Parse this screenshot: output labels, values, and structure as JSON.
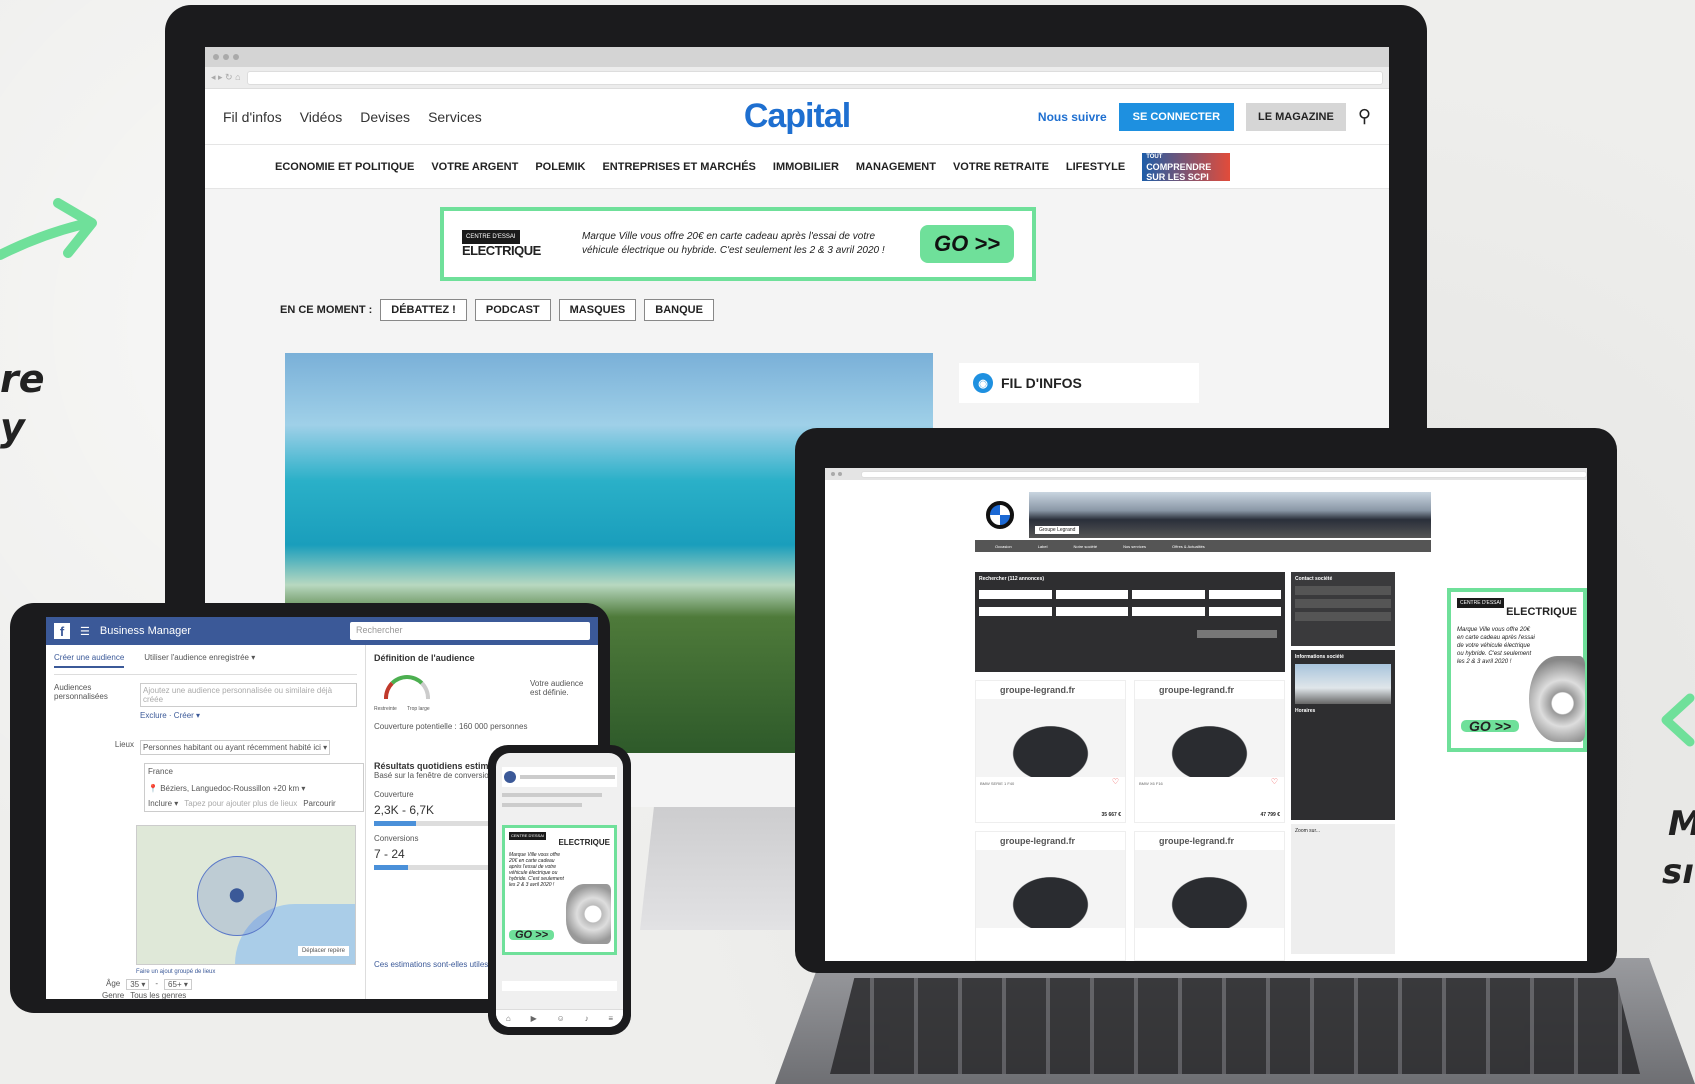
{
  "side_left": {
    "line1": "re",
    "line2": "y"
  },
  "side_right": {
    "line1": "M",
    "line2": "sı"
  },
  "capital": {
    "top_links": [
      "Fil d'infos",
      "Vidéos",
      "Devises",
      "Services"
    ],
    "logo": "Capital",
    "follow": "Nous suivre",
    "connect": "SE CONNECTER",
    "magazine": "LE MAGAZINE",
    "nav": [
      "ECONOMIE ET POLITIQUE",
      "VOTRE ARGENT",
      "POLEMIK",
      "ENTREPRISES ET MARCHÉS",
      "IMMOBILIER",
      "MANAGEMENT",
      "VOTRE RETRAITE",
      "LIFESTYLE"
    ],
    "scpi_line1": "TOUT",
    "scpi_line2": "COMPRENDRE",
    "scpi_line3": "SUR LES SCPI",
    "banner": {
      "tag": "CENTRE D'ESSAI",
      "brand": "ELECTRIQUE",
      "text": "Marque Ville vous offre 20€ en carte cadeau après l'essai de votre véhicule électrique ou hybride. C'est seulement les 2 & 3 avril 2020 !",
      "go": "GO >>"
    },
    "moment_label": "EN CE MOMENT :",
    "moment_tags": [
      "DÉBATTEZ !",
      "PODCAST",
      "MASQUES",
      "BANQUE"
    ],
    "fil": "FIL D'INFOS"
  },
  "facebook": {
    "title": "Business Manager",
    "search": "Rechercher",
    "tab1": "Créer une audience",
    "tab2": "Utiliser l'audience enregistrée ▾",
    "custom": "Audiences personnalisées",
    "custom_ph": "Ajoutez une audience personnalisée ou similaire déjà créée",
    "exclude": "Exclure",
    "create": "Créer ▾",
    "lieux": "Lieux",
    "lieux_sel": "Personnes habitant ou ayant récemment habité ici ▾",
    "country": "France",
    "city": "Béziers, Languedoc-Roussillon",
    "radius": "+20 km ▾",
    "include": "Inclure ▾",
    "add_place": "Tapez pour ajouter plus de lieux",
    "browse": "Parcourir",
    "move_pin": "Déplacer repère",
    "add_many": "Faire un ajout groupé de lieux",
    "age_label": "Âge",
    "age_from": "35 ▾",
    "age_to": "65+ ▾",
    "gender_label": "Genre",
    "gender": "Tous les genres",
    "def_title": "Définition de l'audience",
    "def_side": "Votre audience est définie.",
    "gauge_left": "Restreinte",
    "gauge_right": "Trop large",
    "coverage": "Couverture potentielle : 160 000 personnes",
    "results_title": "Résultats quotidiens estimés",
    "results_sub": "Basé sur la fenêtre de conversion de 7 jours",
    "reach_label": "Couverture",
    "reach": "2,3K - 6,7K",
    "reach_fill": 0.35,
    "conv_label": "Conversions",
    "conv": "7 - 24",
    "conv_fill": 0.28,
    "estimates": "Ces estimations sont-elles utiles ?"
  },
  "phone": {
    "tag": "CENTRE D'ESSAI",
    "brand": "ELECTRIQUE",
    "text": "Marque Ville vous offre 20€ en carte cadeau après l'essai de votre véhicule électrique ou hybride. C'est seulement les 2 & 3 avril 2020 !",
    "go": "GO >>"
  },
  "laptop": {
    "dealer": "Groupe Legrand",
    "nav": [
      "Occasion",
      "Label",
      "Notre société",
      "Nos services",
      "Offres & Actualités"
    ],
    "search_title": "Rechercher (112 annonces)",
    "contact_title": "Contact société",
    "info_title": "Informations société",
    "hours": "Horaires",
    "zoom": "Zoom sur...",
    "cars": [
      {
        "site": "groupe-legrand.fr",
        "model": "BMW SERIE 1 F40",
        "price": "35 667 €"
      },
      {
        "site": "groupe-legrand.fr",
        "model": "BMW X6 F16",
        "price": "47 799 €"
      },
      {
        "site": "groupe-legrand.fr",
        "model": "",
        "price": ""
      },
      {
        "site": "groupe-legrand.fr",
        "model": "",
        "price": ""
      }
    ],
    "ad": {
      "tag": "CENTRE D'ESSAI",
      "brand": "ELECTRIQUE",
      "text": "Marque Ville vous offre 20€ en carte cadeau après l'essai de votre véhicule électrique ou hybride. C'est seulement les 2 & 3 avril 2020 !",
      "go": "GO >>"
    }
  },
  "colors": {
    "accent": "#6fe09a",
    "capital_blue": "#1e6fd0",
    "facebook": "#3b5998"
  }
}
